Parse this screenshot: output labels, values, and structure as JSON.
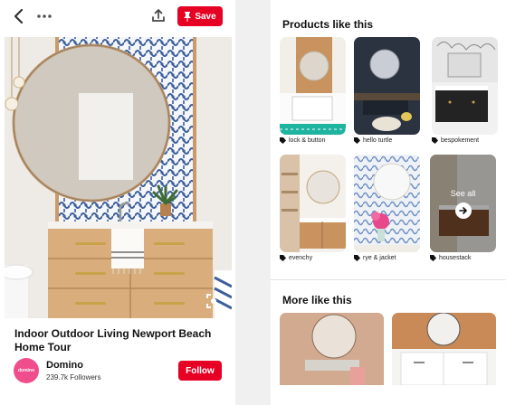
{
  "topbar": {
    "save_label": "Save"
  },
  "pin": {
    "title": "Indoor Outdoor Living Newport Beach Home Tour",
    "author": "Domino",
    "avatar_text": "domino",
    "followers": "239.7k Followers",
    "follow_label": "Follow"
  },
  "products": {
    "heading": "Products like this",
    "items": [
      {
        "label": "lock & button"
      },
      {
        "label": "hello turtle"
      },
      {
        "label": "bespokement"
      },
      {
        "label": "evenchy"
      },
      {
        "label": "rye & jacket"
      },
      {
        "label": "housestack"
      }
    ],
    "see_all_label": "See all"
  },
  "more": {
    "heading": "More like this"
  },
  "colors": {
    "brand_red": "#e60023",
    "tile_blue": "#3d5f9c",
    "wood": "#d9ad7c"
  }
}
